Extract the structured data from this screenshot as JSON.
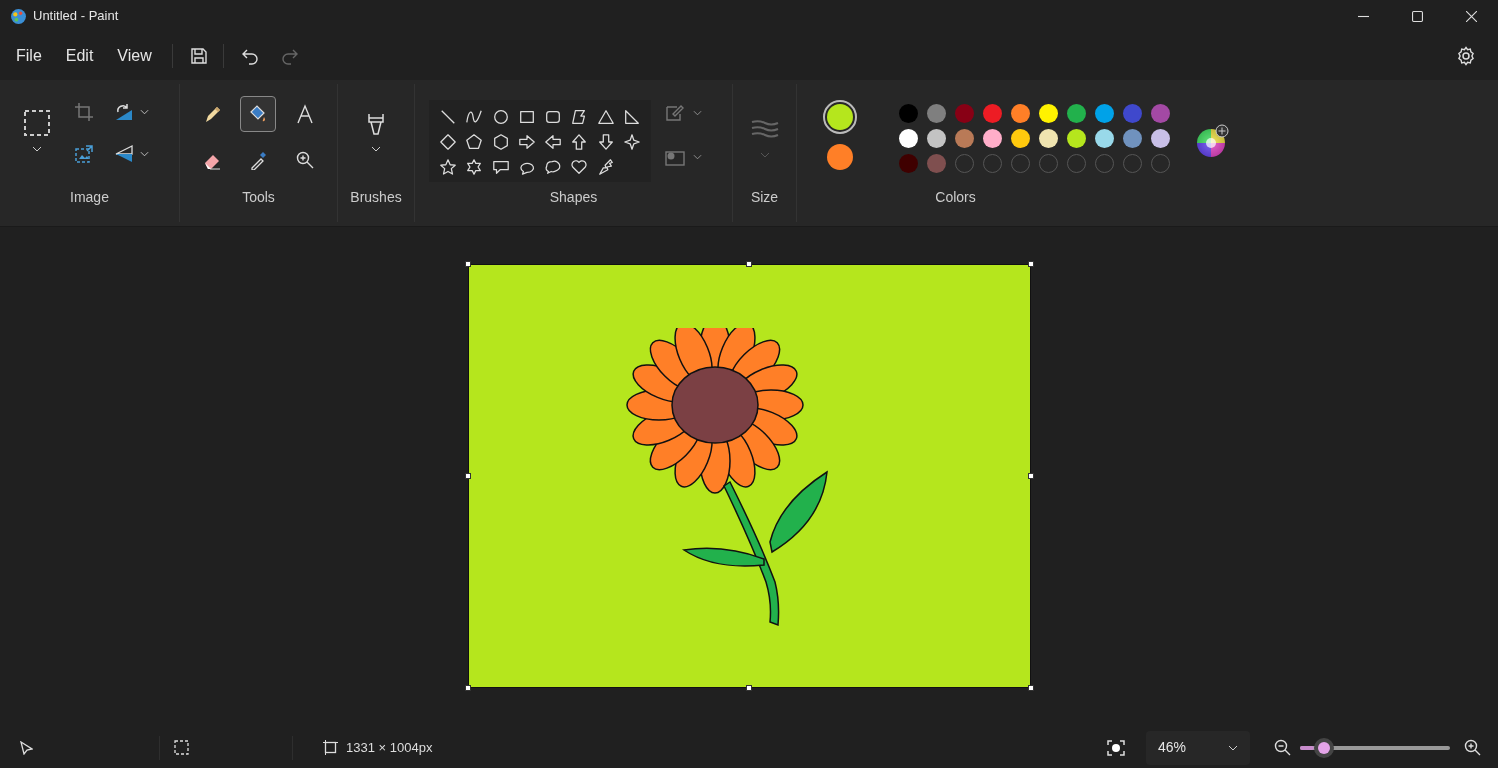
{
  "window": {
    "title": "Untitled - Paint"
  },
  "menu": [
    "File",
    "Edit",
    "View"
  ],
  "groups": [
    {
      "label": "Image"
    },
    {
      "label": "Tools"
    },
    {
      "label": "Brushes"
    },
    {
      "label": "Shapes"
    },
    {
      "label": "Size"
    },
    {
      "label": "Colors"
    }
  ],
  "tools": [
    {
      "selected": false
    },
    {
      "selected": true
    },
    {
      "selected": false
    },
    {
      "selected": false
    },
    {
      "selected": false
    },
    {
      "selected": false
    }
  ],
  "active_colors": [
    {
      "color": "#b5e61d",
      "selected": true
    },
    {
      "color": "#ff7f27",
      "selected": false
    }
  ],
  "palette": [
    [
      {
        "color": "#000000"
      },
      {
        "color": "#7f7f7f"
      },
      {
        "color": "#880015"
      },
      {
        "color": "#ed1c24"
      },
      {
        "color": "#ff7f27"
      },
      {
        "color": "#fff200"
      },
      {
        "color": "#22b14c"
      },
      {
        "color": "#00a2e8"
      },
      {
        "color": "#3f48cc"
      },
      {
        "color": "#a349a4"
      }
    ],
    [
      {
        "color": "#ffffff"
      },
      {
        "color": "#c3c3c3"
      },
      {
        "color": "#b97a57"
      },
      {
        "color": "#ffaec9"
      },
      {
        "color": "#ffc90e"
      },
      {
        "color": "#efe4b0"
      },
      {
        "color": "#b5e61d"
      },
      {
        "color": "#99d9ea"
      },
      {
        "color": "#7092be"
      },
      {
        "color": "#c8bfe7"
      }
    ],
    [
      {
        "color": "#3f0000"
      },
      {
        "color": "#7f4f4f"
      },
      {
        "kind": "empty"
      },
      {
        "kind": "empty"
      },
      {
        "kind": "empty"
      },
      {
        "kind": "empty"
      },
      {
        "kind": "empty"
      },
      {
        "kind": "empty"
      },
      {
        "kind": "empty"
      },
      {
        "kind": "empty"
      }
    ]
  ],
  "status_bar": {
    "canvas_size": "1331 × 1004px",
    "zoom": "46%",
    "zoom_slider": {
      "level": 0.09
    }
  }
}
